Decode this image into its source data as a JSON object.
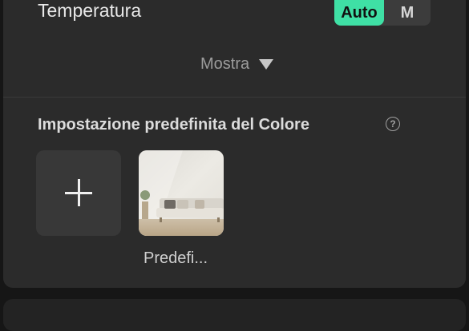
{
  "temperature": {
    "label": "Temperatura",
    "mode_auto_label": "Auto",
    "mode_manual_label": "M",
    "selected_mode": "Auto"
  },
  "show_toggle": {
    "label": "Mostra"
  },
  "color_preset": {
    "title": "Impostazione predefinita del Colore",
    "help_icon": "question-circle-icon",
    "add_icon": "plus-icon",
    "presets": [
      {
        "label": "Predefi..."
      }
    ]
  },
  "colors": {
    "accent": "#3fe0a5",
    "panel_bg": "#2b2b2b",
    "page_bg": "#161616"
  }
}
